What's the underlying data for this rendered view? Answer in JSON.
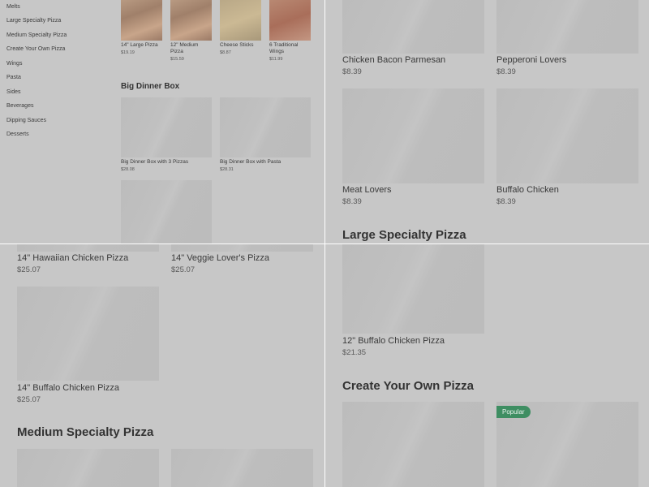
{
  "sidebar": {
    "items": [
      "Melts",
      "Large Specialty Pizza",
      "Medium Specialty Pizza",
      "Create Your Own Pizza",
      "Wings",
      "Pasta",
      "Sides",
      "Beverages",
      "Dipping Sauces",
      "Desserts"
    ]
  },
  "panel1": {
    "top_items": [
      {
        "name": "14\" Large Pizza",
        "price": "$19.19"
      },
      {
        "name": "12\" Medium Pizza",
        "price": "$15.59"
      },
      {
        "name": "Cheese Sticks",
        "price": "$8.87"
      },
      {
        "name": "6 Traditional Wings",
        "price": "$11.99"
      }
    ],
    "section_title": "Big Dinner Box",
    "section_items": [
      {
        "name": "Big Dinner Box with 3 Pizzas",
        "price": "$28.08"
      },
      {
        "name": "Big Dinner Box with Pasta",
        "price": "$28.31"
      }
    ]
  },
  "panel2": {
    "items": [
      {
        "name": "Chicken Bacon Parmesan",
        "price": "$8.39"
      },
      {
        "name": "Pepperoni Lovers",
        "price": "$8.39"
      },
      {
        "name": "Meat Lovers",
        "price": "$8.39"
      },
      {
        "name": "Buffalo Chicken",
        "price": "$8.39"
      }
    ],
    "section_title": "Large Specialty Pizza"
  },
  "panel3": {
    "items": [
      {
        "name": "14\" Hawaiian Chicken Pizza",
        "price": "$25.07"
      },
      {
        "name": "14\" Veggie Lover's Pizza",
        "price": "$25.07"
      },
      {
        "name": "14\" Buffalo Chicken Pizza",
        "price": "$25.07"
      }
    ],
    "section_title": "Medium Specialty Pizza"
  },
  "panel4": {
    "items": [
      {
        "name": "12\" Buffalo Chicken Pizza",
        "price": "$21.35"
      }
    ],
    "section_title": "Create Your Own Pizza",
    "badge": "Popular"
  },
  "colors": {
    "overlay": "#c7c7c7",
    "badge": "#3e8e62",
    "text": "#333333"
  }
}
